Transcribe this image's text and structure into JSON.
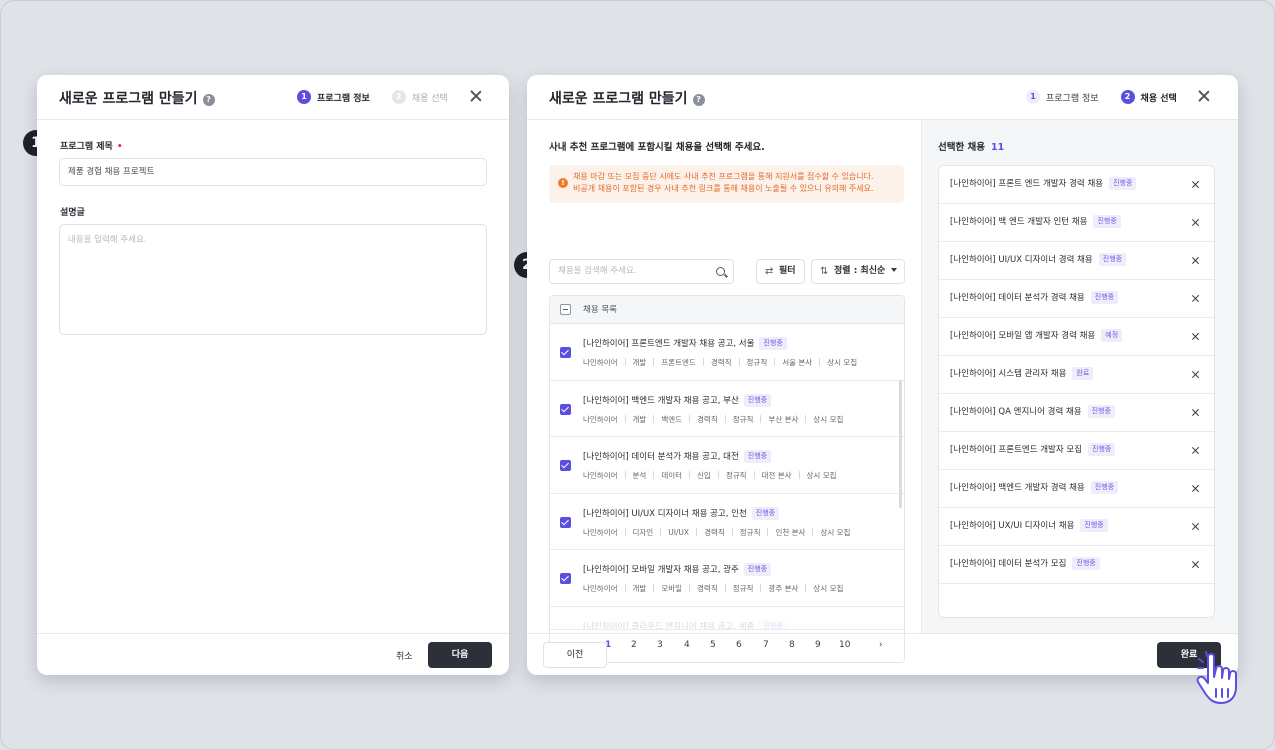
{
  "step_markers": [
    "1",
    "2"
  ],
  "modal1": {
    "title": "새로운 프로그램 만들기",
    "steps": [
      {
        "num": "1",
        "label": "프로그램 정보"
      },
      {
        "num": "2",
        "label": "채용 선택"
      }
    ],
    "program_title_label": "프로그램 제목",
    "required_mark": "•",
    "program_title_value": "제품 경험 채용 프로젝트",
    "description_label": "설명글",
    "description_placeholder": "내용을 입력해 주세요.",
    "cancel_label": "취소",
    "next_label": "다음"
  },
  "modal2": {
    "title": "새로운 프로그램 만들기",
    "steps": [
      {
        "num": "1",
        "label": "프로그램 정보"
      },
      {
        "num": "2",
        "label": "채용 선택"
      }
    ],
    "instruction": "사내 추천 프로그램에 포함시킬 채용을 선택해 주세요.",
    "warning_line1": "채용 마감 또는 모집 중단 시에도 사내 추천 프로그램을 통해 지원서를 접수할 수 있습니다.",
    "warning_line2": "비공개 채용이 포함된 경우 사내 추천 링크를 통해 채용이 노출될 수 있으니 유의해 주세요.",
    "search_placeholder": "채용을 검색해 주세요.",
    "filter_label": "필터",
    "sort_label": "정렬 : 최신순",
    "list_header": "채용 목록",
    "jobs": [
      {
        "title": "[나인하이어] 프론트엔드 개발자 채용 공고, 서울",
        "status": "진행중",
        "meta": [
          "나인하이어",
          "개발",
          "프론트엔드",
          "경력직",
          "정규직",
          "서울 본사",
          "상시 모집"
        ]
      },
      {
        "title": "[나인하이어] 백엔드 개발자 채용 공고, 부산",
        "status": "진행중",
        "meta": [
          "나인하이어",
          "개발",
          "백엔드",
          "경력직",
          "정규직",
          "부산 본사",
          "상시 모집"
        ]
      },
      {
        "title": "[나인하이어] 데이터 분석가 채용 공고, 대전",
        "status": "진행중",
        "meta": [
          "나인하이어",
          "분석",
          "데이터",
          "신입",
          "정규직",
          "대전 본사",
          "상시 모집"
        ]
      },
      {
        "title": "[나인하이어] UI/UX 디자이너 채용 공고, 인천",
        "status": "진행중",
        "meta": [
          "나인하이어",
          "디자인",
          "UI/UX",
          "경력직",
          "정규직",
          "인천 본사",
          "상시 모집"
        ]
      },
      {
        "title": "[나인하이어] 모바일 개발자 채용 공고, 광주",
        "status": "진행중",
        "meta": [
          "나인하이어",
          "개발",
          "모바일",
          "경력직",
          "정규직",
          "광주 본사",
          "상시 모집"
        ]
      },
      {
        "title": "[나인하이어] 클라우드 엔지니어 채용 공고, 세종",
        "status": "진행중",
        "meta": []
      }
    ],
    "pages": [
      "1",
      "2",
      "3",
      "4",
      "5",
      "6",
      "7",
      "8",
      "9",
      "10"
    ],
    "prev_arrow": "‹",
    "next_arrow": "›",
    "selected_title": "선택한 채용",
    "selected_count": "11",
    "selected": [
      {
        "title": "[나인하이어] 프론트 엔드 개발자 경력 채용",
        "status": "진행중"
      },
      {
        "title": "[나인하이어] 백 엔드 개발자 인턴 채용",
        "status": "진행중"
      },
      {
        "title": "[나인하이어] UI/UX 디자이너 경력 채용",
        "status": "진행중"
      },
      {
        "title": "[나인하이어] 데이터 분석가 경력 채용",
        "status": "진행중"
      },
      {
        "title": "[나인하이어] 모바일 앱 개발자 경력 채용",
        "status": "예정"
      },
      {
        "title": "[나인하이어] 시스템 관리자 채용",
        "status": "완료"
      },
      {
        "title": "[나인하이어] QA 엔지니어 경력 채용",
        "status": "진행중"
      },
      {
        "title": "[나인하이어] 프론트엔드 개발자 모집",
        "status": "진행중"
      },
      {
        "title": "[나인하이어] 백엔드 개발자 경력 채용",
        "status": "진행중"
      },
      {
        "title": "[나인하이어] UX/UI 디자이너 채용",
        "status": "진행중"
      },
      {
        "title": "[나인하이어] 데이터 분석가 모집",
        "status": "진행중"
      }
    ],
    "prev_label": "이전",
    "done_label": "완료"
  },
  "colors": {
    "accent": "#5b4fe0",
    "dark_button": "#2c3039",
    "warning": "#e06a2a"
  },
  "icons": [
    "help-icon",
    "close-icon",
    "warning-icon",
    "search-icon",
    "filter-icon",
    "sort-icon",
    "checkbox-icon",
    "remove-icon",
    "pointer-hand-icon"
  ]
}
